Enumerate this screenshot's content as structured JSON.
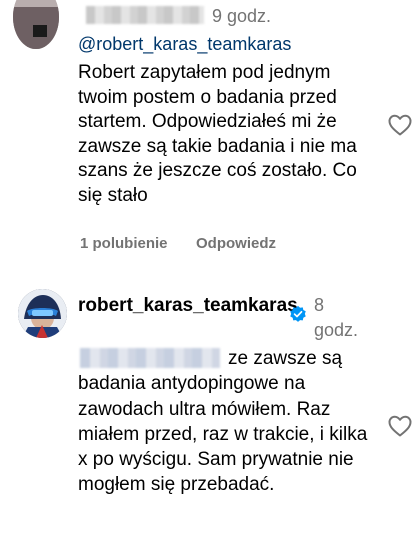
{
  "comment1": {
    "time": "9 godz.",
    "mention": "@robert_karas_teamkaras",
    "text": "Robert zapytałem pod jednym twoim postem o badania przed startem. Odpowiedziałeś mi że zawsze są takie badania i nie ma szans że jeszcze coś zostało. Co się stało",
    "likes": "1 polubienie",
    "reply_label": "Odpowiedz"
  },
  "comment2": {
    "username": "robert_karas_teamkaras",
    "time": "8 godz.",
    "text": "ze zawsze są badania antydopingowe na zawodach ultra mówiłem. Raz miałem przed, raz w trakcie, i kilka x po wyścigu. Sam prywatnie nie mogłem się przebadać."
  },
  "icons": {
    "heart": "heart-outline-icon",
    "verified": "verified-badge-icon",
    "verified_color": "#0095f6"
  }
}
